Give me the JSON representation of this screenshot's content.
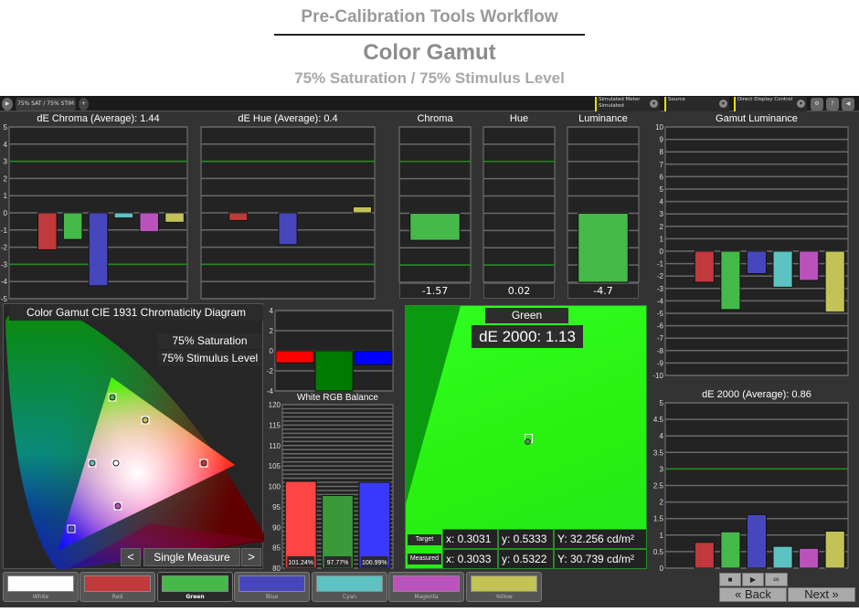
{
  "header": {
    "workflow": "Pre-Calibration Tools Workflow",
    "title": "Color Gamut",
    "subtitle": "75% Saturation / 75% Stimulus Level"
  },
  "toolbar": {
    "tab_label": "75% SAT / 75% STIM",
    "meter_label": "Simulated Meter",
    "meter_value": "Simulated",
    "source_label": "Source",
    "display_label": "Direct Display Control"
  },
  "colors": {
    "White": "#ffffff",
    "Red": "#c0393b",
    "Green": "#45b94a",
    "Blue": "#4747bd",
    "Cyan": "#5cc2c2",
    "Magenta": "#bb52bb",
    "Yellow": "#c2c257",
    "grid": "#6a6a6a",
    "target_line": "#1f8a1f"
  },
  "patches": [
    "White",
    "Red",
    "Green",
    "Blue",
    "Cyan",
    "Magenta",
    "Yellow"
  ],
  "selected_patch": "Green",
  "chart_data": [
    {
      "id": "chroma",
      "type": "bar",
      "title": "dE Chroma (Average): 1.44",
      "categories": [
        "White",
        "Red",
        "Green",
        "Blue",
        "Cyan",
        "Magenta",
        "Yellow"
      ],
      "values": [
        null,
        -2.15,
        -1.55,
        -4.25,
        -0.3,
        -1.1,
        -0.55
      ],
      "ylim": [
        -5,
        5
      ],
      "ticks": [
        5,
        4,
        3,
        2,
        1,
        0,
        -1,
        -2,
        -3,
        -4,
        -5
      ],
      "target_lines": [
        3,
        -3
      ]
    },
    {
      "id": "hue",
      "type": "bar",
      "title": "dE Hue (Average): 0.4",
      "categories": [
        "White",
        "Red",
        "Green",
        "Blue",
        "Cyan",
        "Magenta",
        "Yellow"
      ],
      "values": [
        null,
        -0.45,
        0,
        -1.85,
        0,
        0,
        0.35
      ],
      "ylim": [
        -5,
        5
      ],
      "ticks": [],
      "target_lines": [
        3,
        -3
      ]
    },
    {
      "id": "sel_chroma",
      "type": "bar",
      "title": "Chroma",
      "categories": [
        "Green"
      ],
      "values": [
        -1.57
      ],
      "value_label": "-1.57",
      "ylim": [
        -4,
        5
      ],
      "ticks": [],
      "target_lines": [
        3,
        -3
      ]
    },
    {
      "id": "sel_hue",
      "type": "bar",
      "title": "Hue",
      "categories": [
        "Green"
      ],
      "values": [
        0.02
      ],
      "value_label": "0.02",
      "ylim": [
        -4,
        5
      ],
      "ticks": [],
      "target_lines": [
        3,
        -3
      ]
    },
    {
      "id": "sel_lum",
      "type": "bar",
      "title": "Luminance",
      "categories": [
        "Green"
      ],
      "values": [
        -4.7
      ],
      "value_label": "-4.7",
      "ylim": [
        -4,
        5
      ],
      "ticks": [],
      "target_lines": []
    },
    {
      "id": "gamut_lum",
      "type": "bar",
      "title": "Gamut Luminance",
      "categories": [
        "White",
        "Red",
        "Green",
        "Blue",
        "Cyan",
        "Magenta",
        "Yellow"
      ],
      "values": [
        null,
        -2.5,
        -4.7,
        -1.8,
        -2.9,
        -2.35,
        -4.9
      ],
      "ylim": [
        -10,
        10
      ],
      "ticks": [
        10,
        9,
        8,
        7,
        6,
        5,
        4,
        3,
        2,
        1,
        0,
        -1,
        -2,
        -3,
        -4,
        -5,
        -6,
        -7,
        -8,
        -9,
        -10
      ],
      "target_lines": []
    },
    {
      "id": "de2000",
      "type": "bar",
      "title": "dE 2000 (Average): 0.86",
      "categories": [
        "White",
        "Red",
        "Green",
        "Blue",
        "Cyan",
        "Magenta",
        "Yellow"
      ],
      "values": [
        null,
        0.78,
        1.1,
        1.62,
        0.66,
        0.6,
        1.12
      ],
      "ylim": [
        0,
        5
      ],
      "ticks": [
        5,
        4.5,
        4,
        3.5,
        3,
        2.5,
        2,
        1.5,
        1,
        0.5,
        0
      ],
      "target_lines": [
        3
      ]
    },
    {
      "id": "rgb_dev",
      "type": "bar",
      "title": "",
      "categories": [
        "R",
        "G",
        "B"
      ],
      "values": [
        -1.2,
        -4,
        -1.4
      ],
      "bar_colors": [
        "#ff0000",
        "#007a00",
        "#0000ff"
      ],
      "ylim": [
        -4,
        4
      ],
      "ticks": [
        4,
        2,
        0,
        -2,
        -4
      ],
      "target_lines": []
    },
    {
      "id": "rgb_bal",
      "type": "bar",
      "title": "White RGB Balance",
      "categories": [
        "R",
        "G",
        "B"
      ],
      "values": [
        101.24,
        97.77,
        100.99
      ],
      "value_labels": [
        "101.24%",
        "97.77%",
        "100.99%"
      ],
      "bar_colors": [
        "#ff4444",
        "#3a9a3a",
        "#3a3aff"
      ],
      "ylim": [
        80,
        120
      ],
      "ticks": [
        120,
        115,
        110,
        105,
        100,
        95,
        90,
        85,
        80
      ],
      "target_lines": []
    }
  ],
  "cie": {
    "title": "Color Gamut CIE 1931 Chromaticity Diagram",
    "saturation": "75% Saturation",
    "stimulus": "75% Stimulus Level",
    "prev": "<",
    "mode": "Single Measure",
    "next": ">"
  },
  "detail": {
    "name": "Green",
    "de": "dE 2000: 1.13",
    "target_label": "Target",
    "measured_label": "Measured",
    "target": {
      "x": "x: 0.3031",
      "y": "y: 0.5333",
      "Y": "Y: 32.256 cd/m²"
    },
    "measured": {
      "x": "x: 0.3033",
      "y": "y: 0.5322",
      "Y": "Y: 30.739 cd/m²"
    }
  },
  "nav": {
    "back": "Back",
    "next": "Next"
  }
}
